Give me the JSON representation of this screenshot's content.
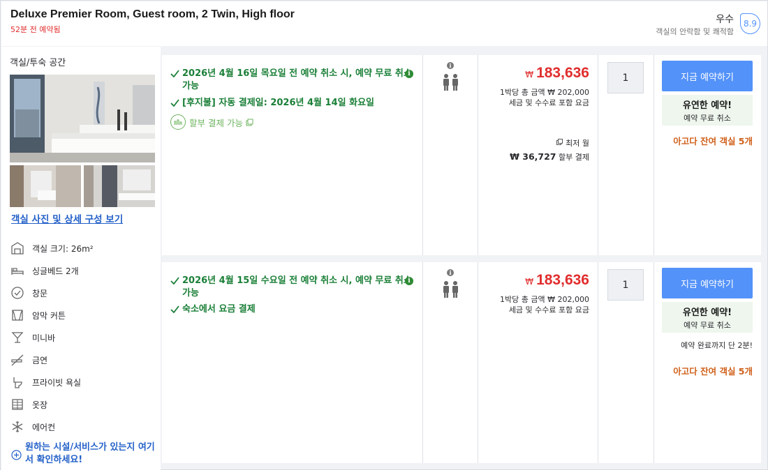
{
  "header": {
    "room_title": "Deluxe Premier Room, Guest room, 2 Twin, High floor",
    "booked_ago": "52분 전 예약됨",
    "score_word": "우수",
    "score_sub": "객실의 안락함 및 쾌적함",
    "score_value": "8.9"
  },
  "left": {
    "heading": "객실/투숙 공간",
    "gallery_link": "객실 사진 및 상세 구성 보기",
    "amenities": [
      {
        "label": "객실 크기: 26m²",
        "icon": "room-size-icon"
      },
      {
        "label": "싱글베드 2개",
        "icon": "bed-icon"
      },
      {
        "label": "창문",
        "icon": "window-icon"
      },
      {
        "label": "암막 커튼",
        "icon": "curtain-icon"
      },
      {
        "label": "미니바",
        "icon": "minibar-icon"
      },
      {
        "label": "금연",
        "icon": "no-smoking-icon"
      },
      {
        "label": "프라이빗 욕실",
        "icon": "toilet-icon"
      },
      {
        "label": "옷장",
        "icon": "wardrobe-icon"
      },
      {
        "label": "에어컨",
        "icon": "snowflake-icon"
      }
    ],
    "facility_link": "원하는 시설/서비스가 있는지 여기서 확인하세요!"
  },
  "offers": [
    {
      "policies": [
        "2026년 4월 16일 목요일 전 예약 취소 시, 예약 무료 취소 가능",
        "[후지불] 자동 결제일: 2026년 4월 14일 화요일"
      ],
      "installment": "할부 결제 가능",
      "currency": "₩",
      "price": "183,636",
      "price_note_1": "1박당 총 금액 ₩ 202,000",
      "price_note_2": "세금 및 수수료 포함 요금",
      "lowest_label": "최저 월",
      "monthly_amount": "₩ 36,727",
      "monthly_suffix": "할부 결제",
      "quantity": "1",
      "book_label": "지금 예약하기",
      "flex_title": "유연한 예약!",
      "flex_sub": "예약 무료 취소",
      "remaining": "아고다 잔여 객실 5개"
    },
    {
      "policies": [
        "2026년 4월 15일 수요일 전 예약 취소 시, 예약 무료 취소 가능",
        "숙소에서 요금 결제"
      ],
      "currency": "₩",
      "price": "183,636",
      "price_note_1": "1박당 총 금액 ₩ 202,000",
      "price_note_2": "세금 및 수수료 포함 요금",
      "quantity": "1",
      "book_label": "지금 예약하기",
      "flex_title": "유연한 예약!",
      "flex_sub": "예약 무료 취소",
      "soon_text": "예약 완료까지 단 2분!",
      "remaining": "아고다 잔여 객실 5개"
    }
  ]
}
